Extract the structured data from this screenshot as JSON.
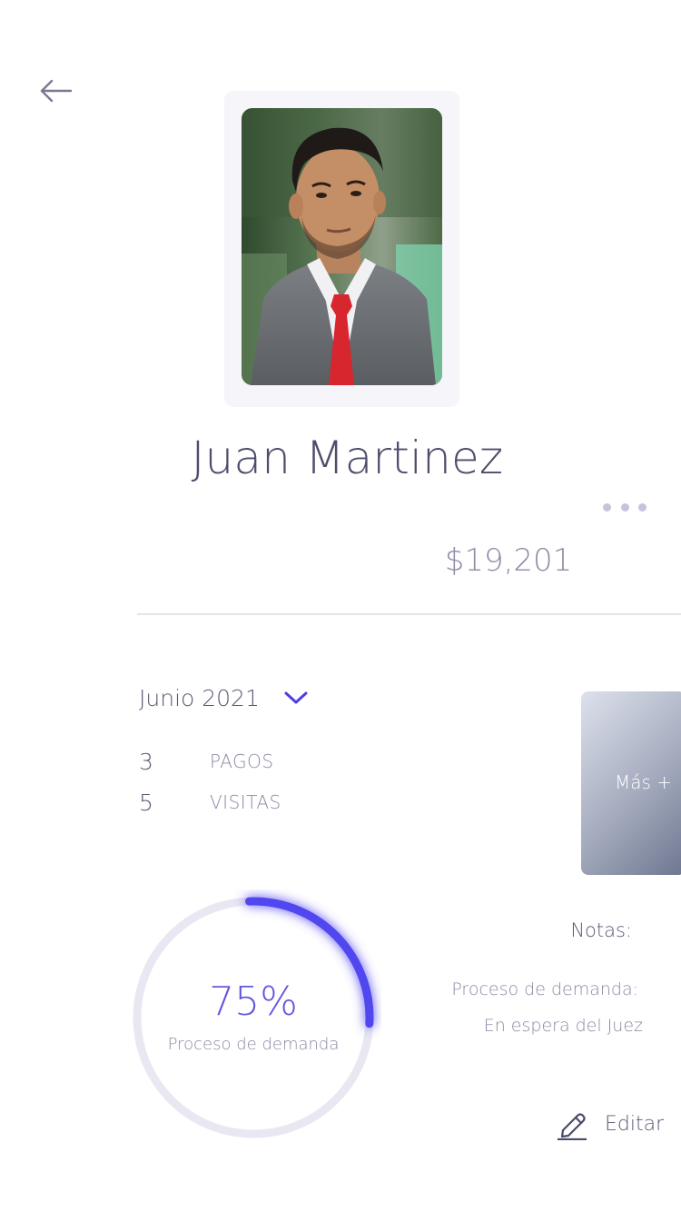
{
  "header": {
    "back_icon": "arrow-left-icon"
  },
  "profile": {
    "name": "Juan Martinez",
    "photo_icon": "profile-photo",
    "amount": "$19,201"
  },
  "menu": {
    "more_icon": "more-horizontal-icon"
  },
  "period": {
    "month_label": "Junio 2021",
    "chevron_icon": "chevron-down-icon"
  },
  "stats": [
    {
      "value": "3",
      "label": "PAGOS"
    },
    {
      "value": "5",
      "label": "VISITAS"
    }
  ],
  "mas_card": {
    "label": "Más +"
  },
  "progress": {
    "percent": 75,
    "value_text": "75%",
    "caption": "Proceso de demanda",
    "track_color": "#e8e8f2",
    "fill_color": "#5147ef"
  },
  "notes": {
    "title": "Notas:",
    "line1": "Proceso de demanda:",
    "line2": "En espera del Juez"
  },
  "edit": {
    "label": "Editar",
    "icon": "pencil-icon"
  },
  "colors": {
    "accent": "#4b3fe0",
    "text": "#4d4d6b",
    "muted": "#8a8aa4"
  }
}
